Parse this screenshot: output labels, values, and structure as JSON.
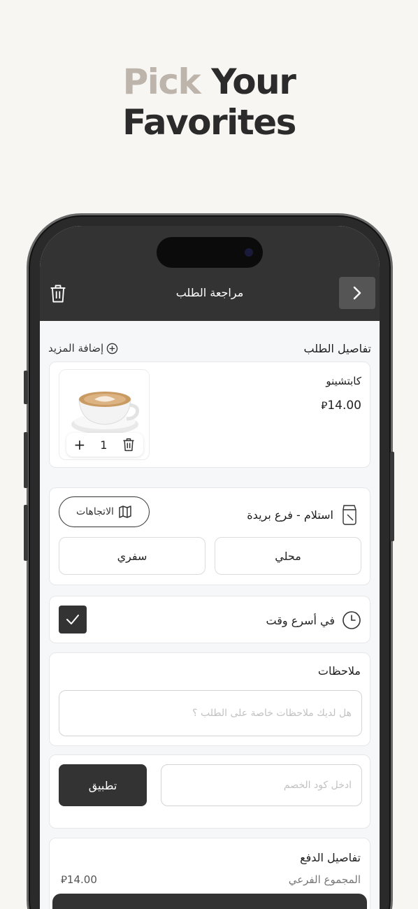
{
  "headline": {
    "light": "Pick",
    "dark1": "Your",
    "dark2": "Favorites"
  },
  "header": {
    "title": "مراجعة الطلب"
  },
  "order": {
    "section_title": "تفاصيل الطلب",
    "add_more": "إضافة المزيد",
    "item": {
      "name": "كابتشينو",
      "price": "14.00",
      "quantity": "1"
    }
  },
  "pickup": {
    "label": "استلام - فرع بريدة",
    "directions": "الاتجاهات",
    "options": [
      "محلي",
      "سفري"
    ]
  },
  "timing": {
    "label": "في أسرع وقت",
    "checked": true
  },
  "notes": {
    "title": "ملاحظات",
    "placeholder": "هل لديك ملاحظات خاصة على الطلب ؟"
  },
  "discount": {
    "placeholder": "ادخل كود الخصم",
    "apply": "تطبيق"
  },
  "payment": {
    "title": "تفاصيل الدفع",
    "subtotal_label": "المجموع الفرعي",
    "subtotal_value": "14.00"
  },
  "colors": {
    "dark": "#333333",
    "accent_light": "#bdb4ab",
    "background": "#f7f6f3"
  }
}
